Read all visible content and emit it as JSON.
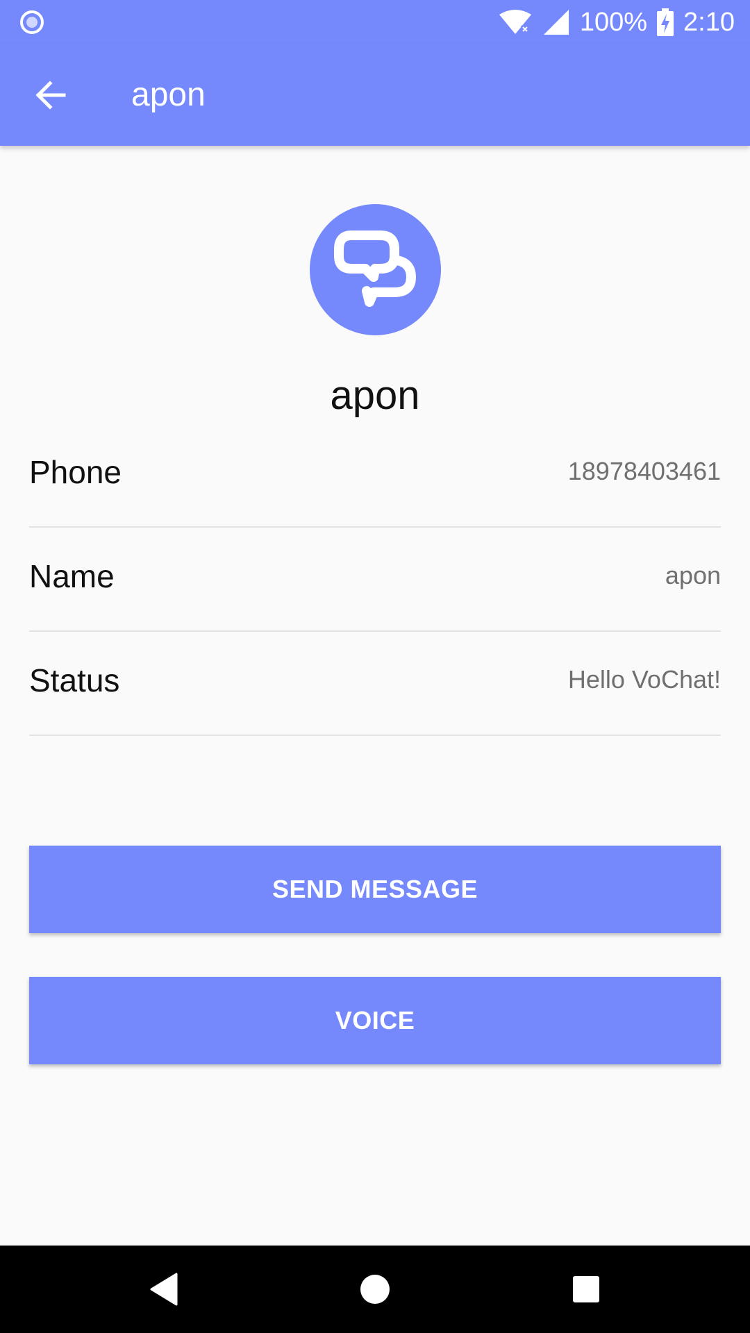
{
  "status_bar": {
    "battery": "100%",
    "time": "2:10",
    "icons": [
      "notification-circle-icon",
      "wifi-icon",
      "signal-icon",
      "battery-charging-icon"
    ]
  },
  "toolbar": {
    "title": "apon",
    "back_icon": "arrow-left-icon"
  },
  "profile": {
    "name": "apon",
    "avatar_icon": "chat-bubbles-icon"
  },
  "details": [
    {
      "label": "Phone",
      "value": "18978403461"
    },
    {
      "label": "Name",
      "value": "apon"
    },
    {
      "label": "Status",
      "value": "Hello VoChat!"
    }
  ],
  "actions": {
    "send_message": "SEND MESSAGE",
    "voice": "VOICE"
  },
  "nav_bar": {
    "icons": [
      "back-triangle-icon",
      "home-circle-icon",
      "recents-square-icon"
    ]
  },
  "colors": {
    "accent": "#7589fd",
    "background": "#fafafa"
  }
}
